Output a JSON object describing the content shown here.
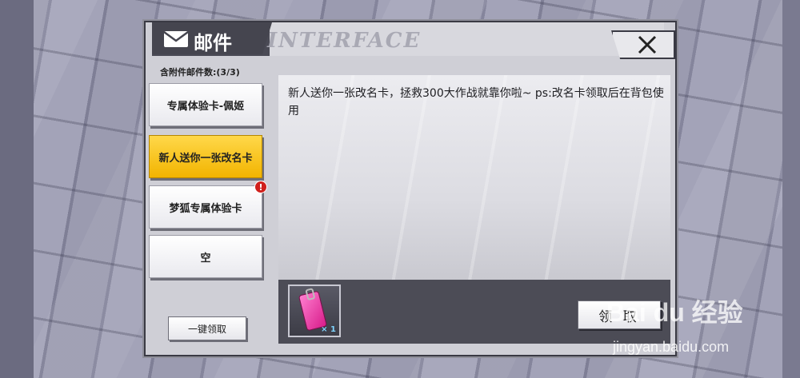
{
  "window": {
    "title": "邮件",
    "banner_text": "INTERFACE"
  },
  "sidebar": {
    "attachment_count_label": "含附件邮件数:(3/3)",
    "items": [
      {
        "label": "专属体验卡-佩姬",
        "active": false,
        "badge": ""
      },
      {
        "label": "新人送你一张改名卡",
        "active": true,
        "badge": ""
      },
      {
        "label": "梦狐专属体验卡",
        "active": false,
        "badge": "!"
      },
      {
        "label": "空",
        "active": false,
        "badge": ""
      }
    ],
    "claim_all_label": "一键领取"
  },
  "mail": {
    "body": "新人送你一张改名卡，拯救300大作战就靠你啦~ ps:改名卡领取后在背包使用",
    "attachment": {
      "icon": "rename-card-icon",
      "quantity": "× 1"
    },
    "claim_label": "领 取"
  },
  "watermark": {
    "logo": "Bai du 经验",
    "url": "jingyan.baidu.com"
  },
  "colors": {
    "active_item": "#f2b400",
    "badge": "#d0201c",
    "panel_dark": "#45454f"
  }
}
